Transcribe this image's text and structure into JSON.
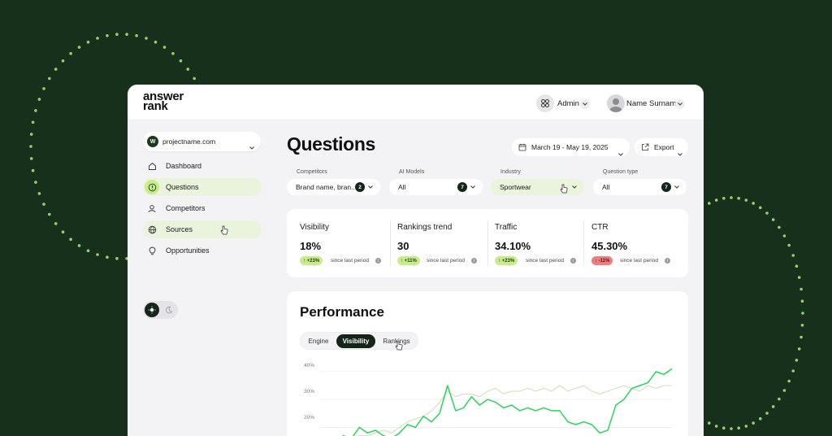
{
  "brand": {
    "line1": "answer",
    "line2": "rank"
  },
  "topbar": {
    "admin_label": "Admin",
    "user_name": "Name Surname"
  },
  "sidebar": {
    "project": "projectname.com",
    "project_initial": "W",
    "items": [
      {
        "label": "Dashboard",
        "icon": "home-icon"
      },
      {
        "label": "Questions",
        "icon": "question-icon",
        "active": true
      },
      {
        "label": "Competitors",
        "icon": "user-icon"
      },
      {
        "label": "Sources",
        "icon": "globe-icon"
      },
      {
        "label": "Opportunities",
        "icon": "lightbulb-icon"
      }
    ],
    "theme": {
      "selected": "light"
    }
  },
  "main": {
    "title": "Questions",
    "date_range": "March 19 - May 19, 2025",
    "export_label": "Export",
    "filters": [
      {
        "label": "Competitors",
        "value": "Brand name, bran...",
        "count": "2"
      },
      {
        "label": "AI Models",
        "value": "All",
        "count": "7"
      },
      {
        "label": "Industry",
        "value": "Sportwear"
      },
      {
        "label": "Question type",
        "value": "All",
        "count": "7"
      }
    ],
    "metrics": [
      {
        "name": "Visibility",
        "value": "18%",
        "delta": "↑ +23%",
        "since": "since last period",
        "positive": true
      },
      {
        "name": "Rankings trend",
        "value": "30",
        "delta": "↑ +11%",
        "since": "since last period",
        "positive": true
      },
      {
        "name": "Traffic",
        "value": "34.10%",
        "delta": "↑ +23%",
        "since": "since last period",
        "positive": true
      },
      {
        "name": "CTR",
        "value": "45.30%",
        "delta": "↓ -11%",
        "since": "since last period",
        "positive": false
      }
    ],
    "performance": {
      "title": "Performance",
      "tabs": [
        "Engine",
        "Visibility",
        "Rankings"
      ],
      "active_tab": "Visibility",
      "y_ticks": [
        "40%",
        "30%",
        "20%"
      ]
    }
  },
  "chart_data": {
    "type": "line",
    "ylim": [
      14,
      42
    ],
    "y_ticks": [
      "40%",
      "30%",
      "20%"
    ],
    "series": [
      {
        "color": "#2bd45a",
        "values": [
          15,
          14,
          15,
          17,
          16,
          20,
          18,
          19,
          17,
          16,
          18,
          21,
          20,
          24,
          22,
          25,
          35,
          26,
          27,
          31,
          28,
          30,
          29,
          27,
          28,
          26,
          27,
          26,
          27,
          26,
          26,
          22,
          21,
          22,
          21,
          18,
          19,
          28,
          30,
          34,
          35,
          36,
          40,
          39,
          41
        ]
      },
      {
        "color": "#d9dcc0",
        "values": [
          14,
          15,
          15,
          16,
          16,
          17,
          17,
          18,
          19,
          18,
          20,
          22,
          23,
          24,
          26,
          29,
          33,
          31,
          32,
          32,
          31,
          33,
          34,
          32,
          33,
          33,
          34,
          33,
          34,
          33,
          35,
          33,
          34,
          35,
          33,
          32,
          33,
          34,
          35,
          34,
          33,
          35,
          34,
          35,
          35
        ]
      }
    ]
  }
}
